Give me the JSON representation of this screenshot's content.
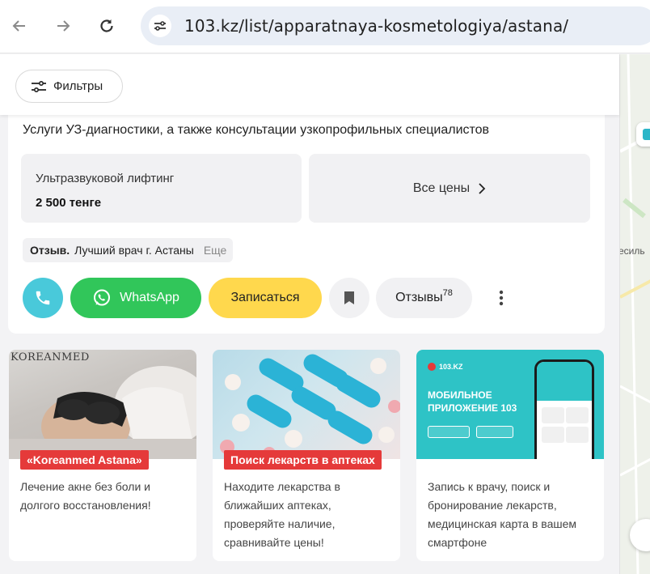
{
  "browser": {
    "url": "103.kz/list/apparatnaya-kosmetologiya/astana/"
  },
  "filters": {
    "label": "Фильтры"
  },
  "card": {
    "description": "Услуги УЗ-диагностики, а также консультации узкопрофильных специалистов",
    "price_name": "Ультразвуковой лифтинг",
    "price_value": "2 500 тенге",
    "all_prices": "Все цены",
    "review_prefix": "Отзыв.",
    "review_text": "Лучший врач г. Астаны",
    "review_more": "Еще",
    "whatsapp": "WhatsApp",
    "book": "Записаться",
    "reviews_label": "Отзывы",
    "reviews_count": "78"
  },
  "map": {
    "label": "есиль"
  },
  "promos": [
    {
      "logo": "KOREANMED",
      "tag": "«Koreanmed Astana»",
      "text": "Лечение акне без боли и долгого восстановления!"
    },
    {
      "tag": "Поиск лекарств в аптеках",
      "text": "Находите лекарства в ближайших аптеках, проверяйте наличие, сравнивайте цены!"
    },
    {
      "brand": "103.KZ",
      "headline1": "МОБИЛЬНОЕ",
      "headline2": "ПРИЛОЖЕНИЕ 103",
      "text": "Запись к врачу, поиск и бронирование лекарств, медицинская карта в вашем смартфоне"
    }
  ]
}
